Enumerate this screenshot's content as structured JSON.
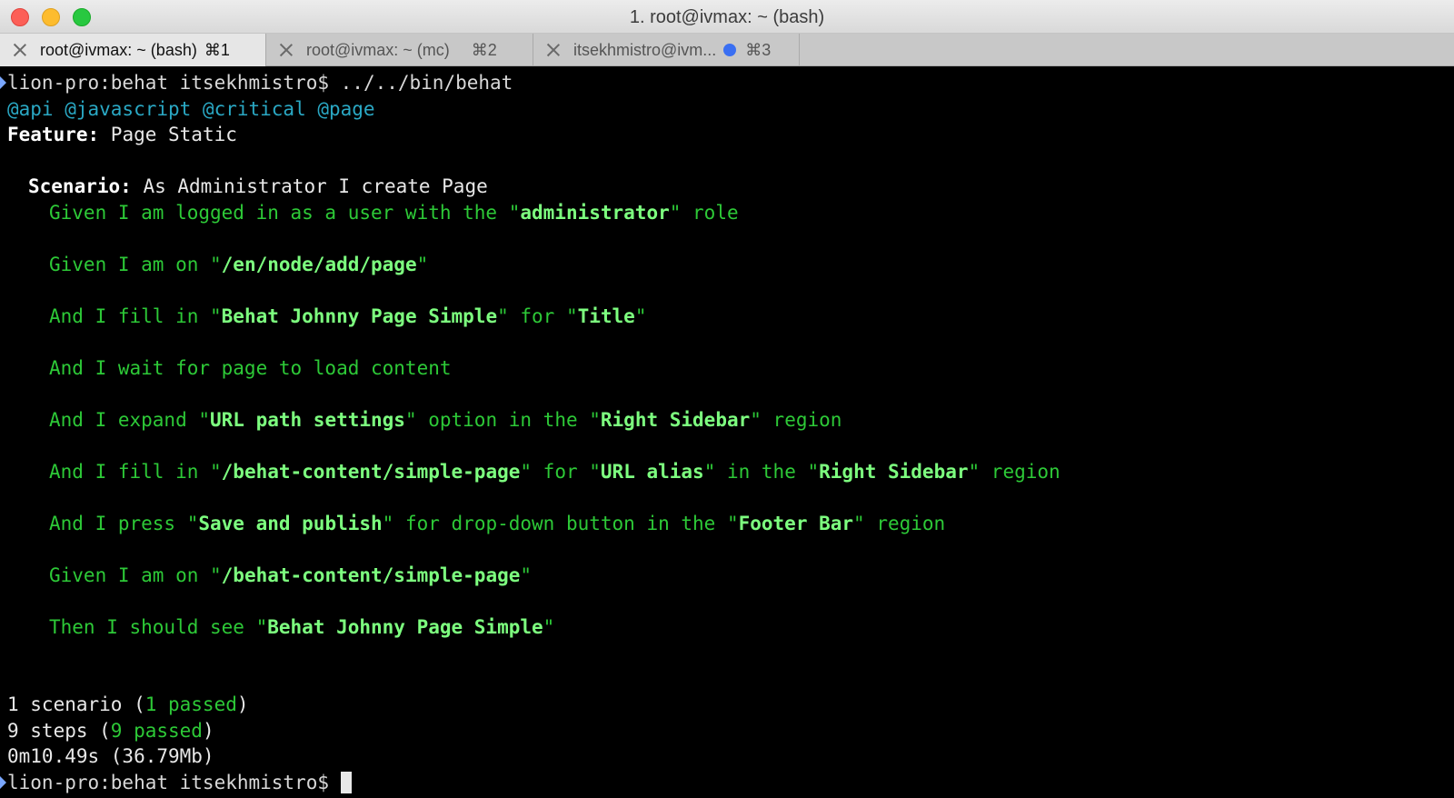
{
  "window": {
    "title": "1. root@ivmax: ~ (bash)"
  },
  "tabs": [
    {
      "label": "root@ivmax: ~ (bash)",
      "shortcut": "⌘1",
      "active": true
    },
    {
      "label": "root@ivmax: ~ (mc)",
      "shortcut": "⌘2",
      "active": false
    },
    {
      "label": "itsekhmistro@ivm...",
      "shortcut": "⌘3",
      "active": false,
      "activity_dot_color": "#3a6ff2"
    }
  ],
  "terminal": {
    "prompt": "lion-pro:behat itsekhmistro$",
    "command": " ../../bin/behat",
    "tags": "@api @javascript @critical @page",
    "feature_label": "Feature:",
    "feature_name": " Page Static",
    "scenario_label": "Scenario:",
    "scenario_name": " As Administrator I create Page",
    "steps": {
      "s1": {
        "a": "Given I am logged in as a user with the \"",
        "b": "administrator",
        "c": "\" role"
      },
      "s2": {
        "a": "Given I am on \"",
        "b": "/en/node/add/page",
        "c": "\""
      },
      "s3": {
        "a": "And I fill in \"",
        "b": "Behat Johnny Page Simple",
        "c": "\" for \"",
        "d": "Title",
        "e": "\""
      },
      "s4": {
        "a": "And I wait for page to load content"
      },
      "s5": {
        "a": "And I expand \"",
        "b": "URL path settings",
        "c": "\" option in the \"",
        "d": "Right Sidebar",
        "e": "\" region"
      },
      "s6": {
        "a": "And I fill in \"",
        "b": "/behat-content/simple-page",
        "c": "\" for \"",
        "d": "URL alias",
        "e": "\" in the \"",
        "f": "Right Sidebar",
        "g": "\" region"
      },
      "s7": {
        "a": "And I press \"",
        "b": "Save and publish",
        "c": "\" for drop-down button in the \"",
        "d": "Footer Bar",
        "e": "\" region"
      },
      "s8": {
        "a": "Given I am on \"",
        "b": "/behat-content/simple-page",
        "c": "\""
      },
      "s9": {
        "a": "Then I should see \"",
        "b": "Behat Johnny Page Simple",
        "c": "\""
      }
    },
    "summary": {
      "scenarios_pre": "1 scenario (",
      "scenarios_passed": "1 passed",
      "scenarios_post": ")",
      "steps_pre": "9 steps (",
      "steps_passed": "9 passed",
      "steps_post": ")",
      "timing": "0m10.49s (36.79Mb)"
    },
    "final_prompt": "lion-pro:behat itsekhmistro$ "
  },
  "colors": {
    "tag_cyan": "#2aa8c4",
    "step_green": "#2dc937",
    "arg_green_bold": "#7dff7f",
    "background": "#000000"
  }
}
